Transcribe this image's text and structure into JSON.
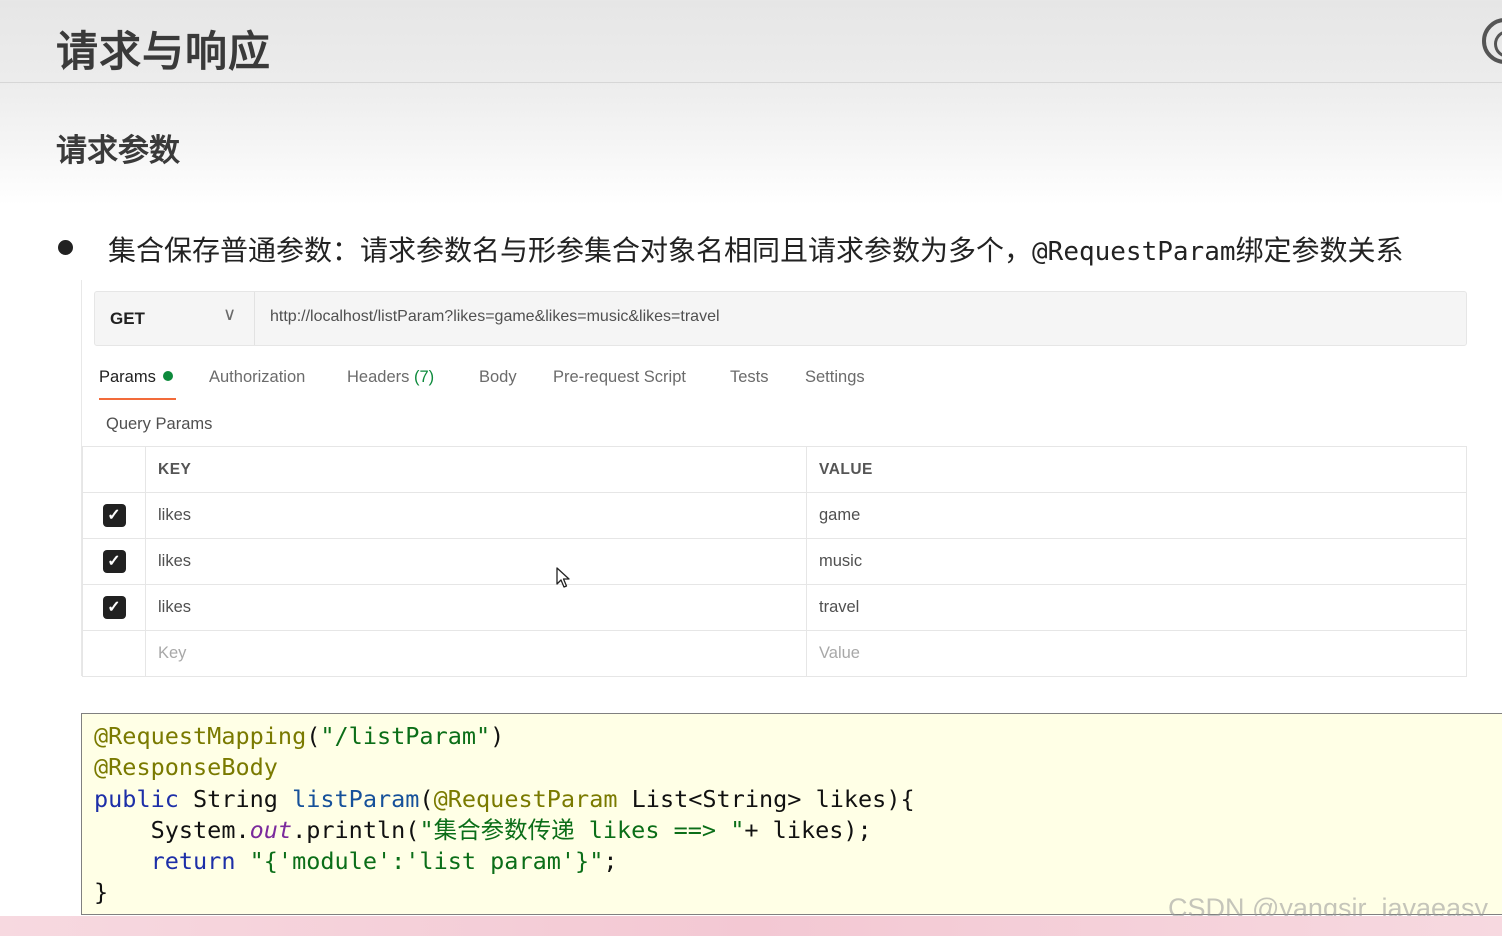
{
  "slide": {
    "title": "请求与响应",
    "subtitle": "请求参数",
    "bullet": {
      "text_prefix": "集合保存普通参数：请求参数名与形参集合对象名相同且请求参数为多个，",
      "annotation": "@RequestParam",
      "text_suffix": "绑定参数关系"
    }
  },
  "postman": {
    "method": "GET",
    "url": "http://localhost/listParam?likes=game&likes=music&likes=travel",
    "tabs": [
      {
        "label": "Params"
      },
      {
        "label": "Authorization"
      },
      {
        "label": "Headers",
        "count": "(7)"
      },
      {
        "label": "Body"
      },
      {
        "label": "Pre-request Script"
      },
      {
        "label": "Tests"
      },
      {
        "label": "Settings"
      }
    ],
    "query_params_label": "Query Params",
    "table": {
      "headers": [
        "KEY",
        "VALUE"
      ],
      "rows": [
        {
          "key": "likes",
          "value": "game",
          "checked": true
        },
        {
          "key": "likes",
          "value": "music",
          "checked": true
        },
        {
          "key": "likes",
          "value": "travel",
          "checked": true
        }
      ],
      "placeholder": {
        "key": "Key",
        "value": "Value"
      }
    }
  },
  "code": {
    "l1_ann": "@RequestMapping",
    "l1_open": "(",
    "l1_str": "\"/listParam\"",
    "l1_close": ")",
    "l2_ann": "@ResponseBody",
    "l3_kw": "public",
    "l3_type": " String ",
    "l3_fn": "listParam",
    "l3_open": "(",
    "l3_ann": "@RequestParam",
    "l3_rest": " List<String> likes){",
    "l4_indent": "    System.",
    "l4_field": "out",
    "l4_call": ".println(",
    "l4_str": "\"集合参数传递 likes ==> \"",
    "l4_rest": "+ likes);",
    "l5_indent": "    ",
    "l5_kw": "return",
    "l5_sp": " ",
    "l5_str": "\"{'module':'list param'}\"",
    "l5_rest": ";",
    "l6": "}"
  },
  "watermark": "CSDN @yangsir_javaeasy",
  "colors": {
    "accent_tab": "#f26b3a",
    "status_green": "#0d8a3c",
    "code_bg": "#ffffe6"
  },
  "icons": [
    "chevron-down-icon",
    "green-dot-icon",
    "checkbox-checked-icon",
    "mouse-cursor-icon",
    "logo-icon"
  ]
}
